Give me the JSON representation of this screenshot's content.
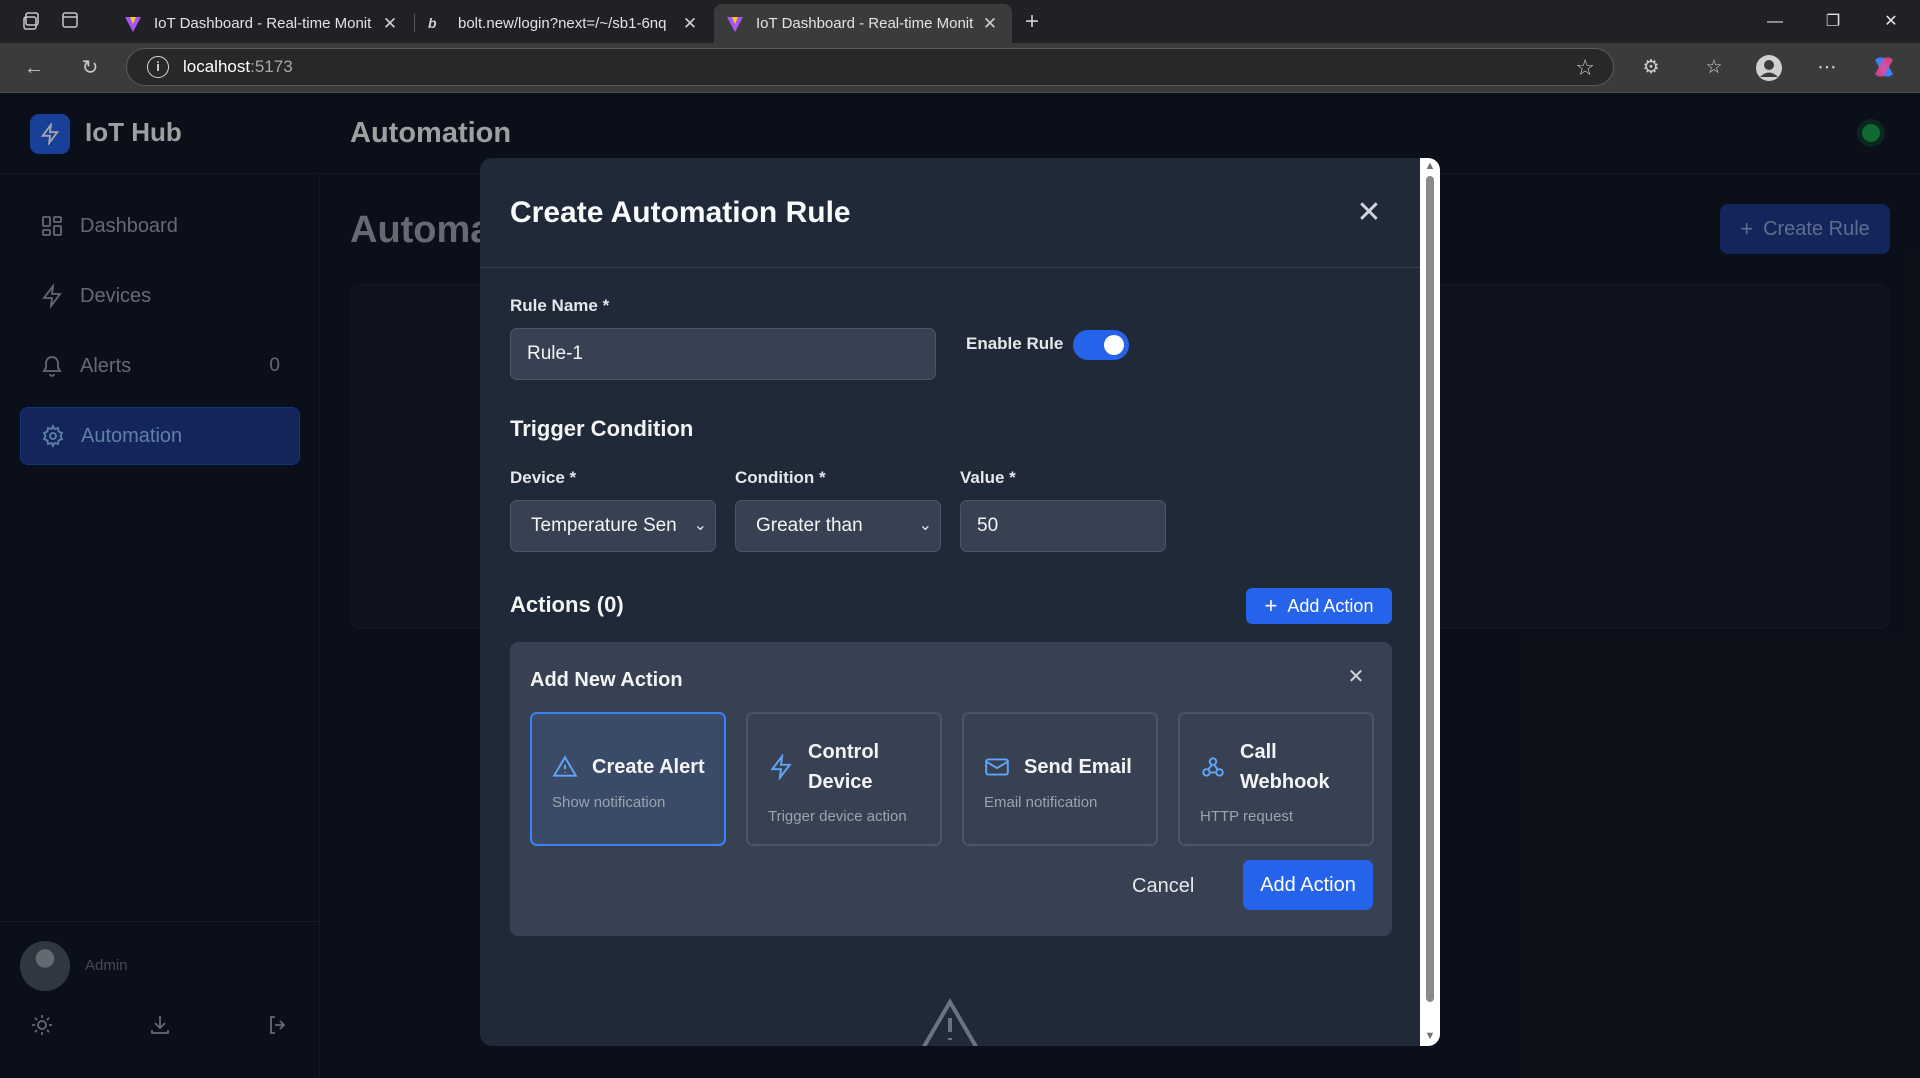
{
  "browser": {
    "tabs": [
      {
        "title": "IoT Dashboard - Real-time Monit"
      },
      {
        "title": "bolt.new/login?next=/~/sb1-6nq"
      },
      {
        "title": "IoT Dashboard - Real-time Monit"
      }
    ],
    "url_host": "localhost",
    "url_port": ":5173"
  },
  "app": {
    "brand": "IoT Hub",
    "header_title": "Automation",
    "page_title": "Automa",
    "create_rule_label": "Create Rule",
    "user_name": "Admin",
    "sidebar": [
      {
        "label": "Dashboard",
        "icon": "grid-icon"
      },
      {
        "label": "Devices",
        "icon": "bolt-icon"
      },
      {
        "label": "Alerts",
        "icon": "bell-icon",
        "count": "0"
      },
      {
        "label": "Automation",
        "icon": "gear-icon",
        "active": true
      }
    ],
    "colors": {
      "accent": "#2563eb",
      "status": "#16a34a"
    }
  },
  "modal": {
    "title": "Create Automation Rule",
    "rule_name_label": "Rule Name *",
    "rule_name_value": "Rule-1",
    "enable_rule_label": "Enable Rule",
    "enable_rule_on": true,
    "trigger_title": "Trigger Condition",
    "device_label": "Device *",
    "device_value": "Temperature Sen",
    "condition_label": "Condition *",
    "condition_value": "Greater than",
    "value_label": "Value *",
    "value_value": "50",
    "actions_title": "Actions (0)",
    "add_action_label": "Add Action",
    "panel": {
      "title": "Add New Action",
      "options": [
        {
          "title": "Create Alert",
          "desc": "Show notification",
          "icon": "warning-icon",
          "selected": true
        },
        {
          "title": "Control Device",
          "title_l1": "Control",
          "title_l2": "Device",
          "desc": "Trigger device action",
          "icon": "bolt-icon"
        },
        {
          "title": "Send Email",
          "desc": "Email notification",
          "icon": "mail-icon"
        },
        {
          "title": "Call Webhook",
          "title_l1": "Call",
          "title_l2": "Webhook",
          "desc": "HTTP request",
          "icon": "webhook-icon"
        }
      ],
      "cancel_label": "Cancel",
      "submit_label": "Add Action"
    }
  }
}
